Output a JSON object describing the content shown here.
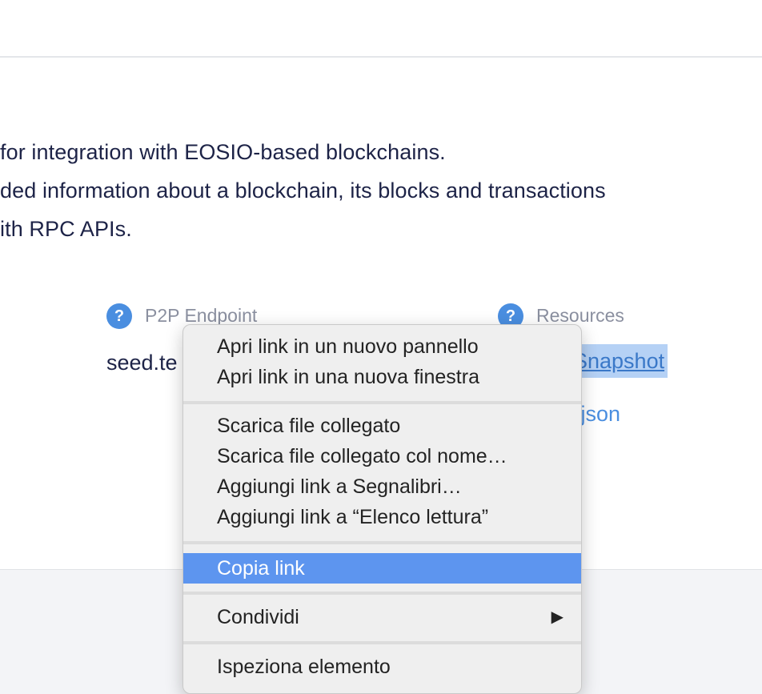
{
  "intro": {
    "lines": [
      "for integration with EOSIO-based blockchains.",
      "ded information about a blockchain, its blocks and transactions",
      "ith RPC APIs."
    ]
  },
  "fields": {
    "p2p": {
      "label": "P2P Endpoint",
      "value": "seed.te"
    },
    "resources": {
      "label": "Resources",
      "link_snapshot": "Snapshot",
      "link_json": ".json"
    }
  },
  "context_menu": {
    "items": [
      "Apri link in un nuovo pannello",
      "Apri link in una nuova finestra",
      "Scarica file collegato",
      "Scarica file collegato col nome…",
      "Aggiungi link a Segnalibri…",
      "Aggiungi link a “Elenco lettura”",
      "Copia link",
      "Condividi",
      "Ispeziona elemento"
    ],
    "submenu_arrow": "▶"
  },
  "colors": {
    "accent": "#4a8ee0",
    "menu_highlight": "#5d95ef",
    "text_dark": "#1d2347"
  }
}
